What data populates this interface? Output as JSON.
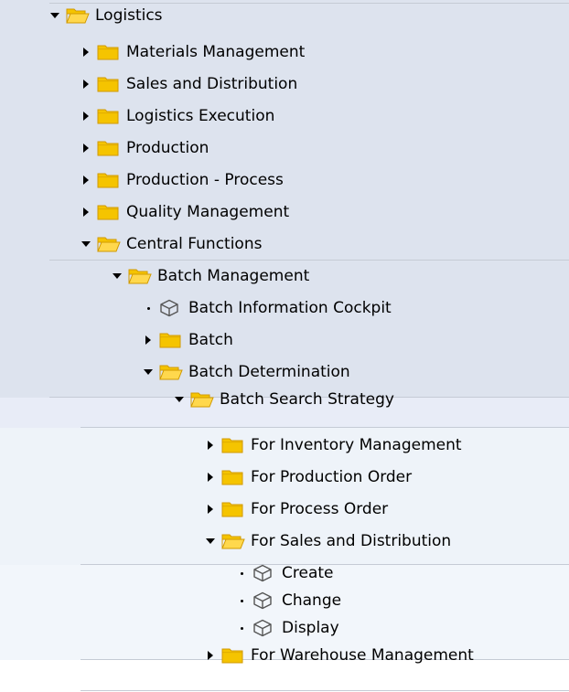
{
  "tree": [
    {
      "label": "Logistics",
      "kind": "folder",
      "state": "expanded",
      "level": 0
    },
    {
      "label": "Materials Management",
      "kind": "folder",
      "state": "collapsed",
      "level": 1
    },
    {
      "label": "Sales and Distribution",
      "kind": "folder",
      "state": "collapsed",
      "level": 1
    },
    {
      "label": "Logistics Execution",
      "kind": "folder",
      "state": "collapsed",
      "level": 1
    },
    {
      "label": "Production",
      "kind": "folder",
      "state": "collapsed",
      "level": 1
    },
    {
      "label": "Production - Process",
      "kind": "folder",
      "state": "collapsed",
      "level": 1
    },
    {
      "label": "Quality Management",
      "kind": "folder",
      "state": "collapsed",
      "level": 1
    },
    {
      "label": "Central Functions",
      "kind": "folder",
      "state": "expanded",
      "level": 1
    },
    {
      "label": "Batch Management",
      "kind": "folder",
      "state": "expanded",
      "level": 2
    },
    {
      "label": "Batch Information Cockpit",
      "kind": "transaction",
      "state": "leaf",
      "level": 3
    },
    {
      "label": "Batch",
      "kind": "folder",
      "state": "collapsed",
      "level": 3
    },
    {
      "label": "Batch Determination",
      "kind": "folder",
      "state": "expanded",
      "level": 3
    },
    {
      "label": "Batch Search Strategy",
      "kind": "folder",
      "state": "expanded",
      "level": 4
    },
    {
      "label": "For Inventory Management",
      "kind": "folder",
      "state": "collapsed",
      "level": 5
    },
    {
      "label": "For Production Order",
      "kind": "folder",
      "state": "collapsed",
      "level": 5
    },
    {
      "label": "For Process Order",
      "kind": "folder",
      "state": "collapsed",
      "level": 5
    },
    {
      "label": "For Sales and Distribution",
      "kind": "folder",
      "state": "expanded",
      "level": 5
    },
    {
      "label": "Create",
      "kind": "transaction",
      "state": "leaf",
      "level": 6
    },
    {
      "label": "Change",
      "kind": "transaction",
      "state": "leaf",
      "level": 6
    },
    {
      "label": "Display",
      "kind": "transaction",
      "state": "leaf",
      "level": 6
    },
    {
      "label": "For Warehouse Management",
      "kind": "folder",
      "state": "collapsed",
      "level": 5
    }
  ],
  "colors": {
    "folder_fill": "#f5c400",
    "folder_edge": "#d19a00",
    "folder_open_fill": "#ffd84d",
    "transaction_icon": "#555555"
  }
}
